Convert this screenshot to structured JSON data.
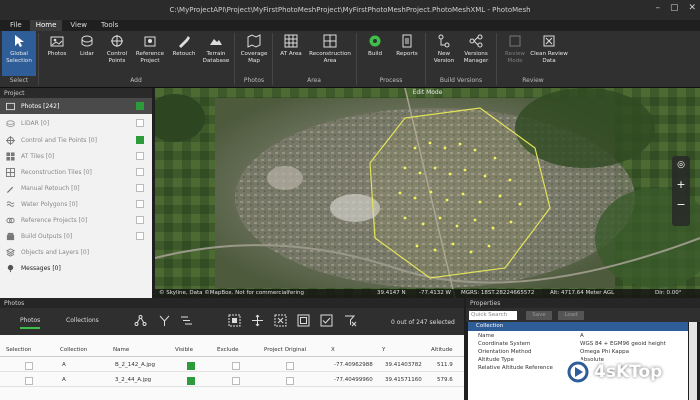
{
  "window": {
    "title": "C:\\MyProjectAPI\\Project\\MyFirstPhotoMeshProject\\MyFirstPhotoMeshProject.PhotoMeshXML - PhotoMesh"
  },
  "menu": [
    "File",
    "Home",
    "View",
    "Tools"
  ],
  "ribbon": {
    "buttons": [
      {
        "label": "Global Selection",
        "icon": "cursor-icon"
      },
      {
        "label": "Photos",
        "icon": "photos-icon"
      },
      {
        "label": "Lidar",
        "icon": "lidar-icon"
      },
      {
        "label": "Control Points",
        "icon": "control-points-icon"
      },
      {
        "label": "Reference Project",
        "icon": "reference-project-icon"
      },
      {
        "label": "Retouch",
        "icon": "retouch-icon"
      },
      {
        "label": "Terrain Database",
        "icon": "terrain-database-icon"
      },
      {
        "label": "Coverage Map",
        "icon": "coverage-map-icon"
      },
      {
        "label": "AT Area",
        "icon": "at-area-icon"
      },
      {
        "label": "Reconstruction Area",
        "icon": "reconstruction-area-icon"
      },
      {
        "label": "Build",
        "icon": "build-icon"
      },
      {
        "label": "Reports",
        "icon": "reports-icon"
      },
      {
        "label": "New Version",
        "icon": "new-version-icon"
      },
      {
        "label": "Versions Manager",
        "icon": "versions-manager-icon"
      },
      {
        "label": "Review Mode",
        "icon": "review-mode-icon"
      },
      {
        "label": "Clean Review Data",
        "icon": "clean-review-data-icon"
      }
    ],
    "groups": [
      "Select",
      "Add",
      "Photos",
      "Area",
      "Process",
      "Build Versions",
      "Review"
    ]
  },
  "project": {
    "header": "Project",
    "items": [
      {
        "label": "Photos [242]",
        "icon": "photos-icon",
        "checked": true
      },
      {
        "label": "LiDAR [0]",
        "icon": "lidar-icon",
        "checked": false
      },
      {
        "label": "Control and Tie Points [0]",
        "icon": "control-points-icon",
        "checked": true
      },
      {
        "label": "AT Tiles [0]",
        "icon": "at-tiles-icon",
        "checked": false
      },
      {
        "label": "Reconstruction Tiles [0]",
        "icon": "reconstruction-tiles-icon",
        "checked": false
      },
      {
        "label": "Manual Retouch [0]",
        "icon": "retouch-icon",
        "checked": false
      },
      {
        "label": "Water Polygons [0]",
        "icon": "water-polygons-icon",
        "checked": false
      },
      {
        "label": "Reference Projects [0]",
        "icon": "reference-project-icon",
        "checked": false
      },
      {
        "label": "Build Outputs [0]",
        "icon": "build-outputs-icon",
        "checked": false
      },
      {
        "label": "Objects and Layers [0]",
        "icon": "layers-icon",
        "checked": false
      },
      {
        "label": "Messages [0]",
        "icon": "messages-icon",
        "checked": false
      }
    ]
  },
  "map": {
    "mode": "Edit Mode",
    "status": {
      "credits": "© Skyline, Data ©MapBox. Not for commercialfering",
      "lat": "39.4147 N",
      "lon": "-77.4132 W",
      "mgrs": "MGRS: 18ST.28224665572",
      "alt": "Alt: 4717.64 Meter AGL",
      "dir": "Dir: 0.00°"
    }
  },
  "photos": {
    "header": "Photos",
    "tabs": [
      "Photos",
      "Collections"
    ],
    "selection_count": "0 out of 247 selected",
    "columns": [
      "Selection",
      "Collection",
      "Name",
      "Visible",
      "Exclude",
      "Project Original",
      "X",
      "Y",
      "Altitude"
    ],
    "rows": [
      {
        "collection": "A",
        "name": "B_2_142_A.jpg",
        "visible": true,
        "x": "-77.40962988",
        "y": "39.41403782",
        "altitude": "511.9"
      },
      {
        "collection": "A",
        "name": "3_2_44_A.jpg",
        "visible": true,
        "x": "-77.40499960",
        "y": "39.41571160",
        "altitude": "579.6"
      }
    ]
  },
  "properties": {
    "header": "Properties",
    "search_placeholder": "Quick Search",
    "save_label": "Save",
    "load_label": "Load",
    "section": "Collection",
    "rows": [
      {
        "key": "Name",
        "value": "A"
      },
      {
        "key": "Coordinate System",
        "value": "WGS 84 + EGM96 geoid height"
      },
      {
        "key": "Orientation Method",
        "value": "Omega Phi Kappa"
      },
      {
        "key": "Altitude Type",
        "value": "Absolute"
      },
      {
        "key": "Relative Altitude Reference",
        "value": ""
      }
    ]
  },
  "watermark": "4sKTop",
  "colors": {
    "accent": "#2e5d97",
    "check": "#2d9b3a",
    "tab_underline": "#3fbf4a"
  }
}
